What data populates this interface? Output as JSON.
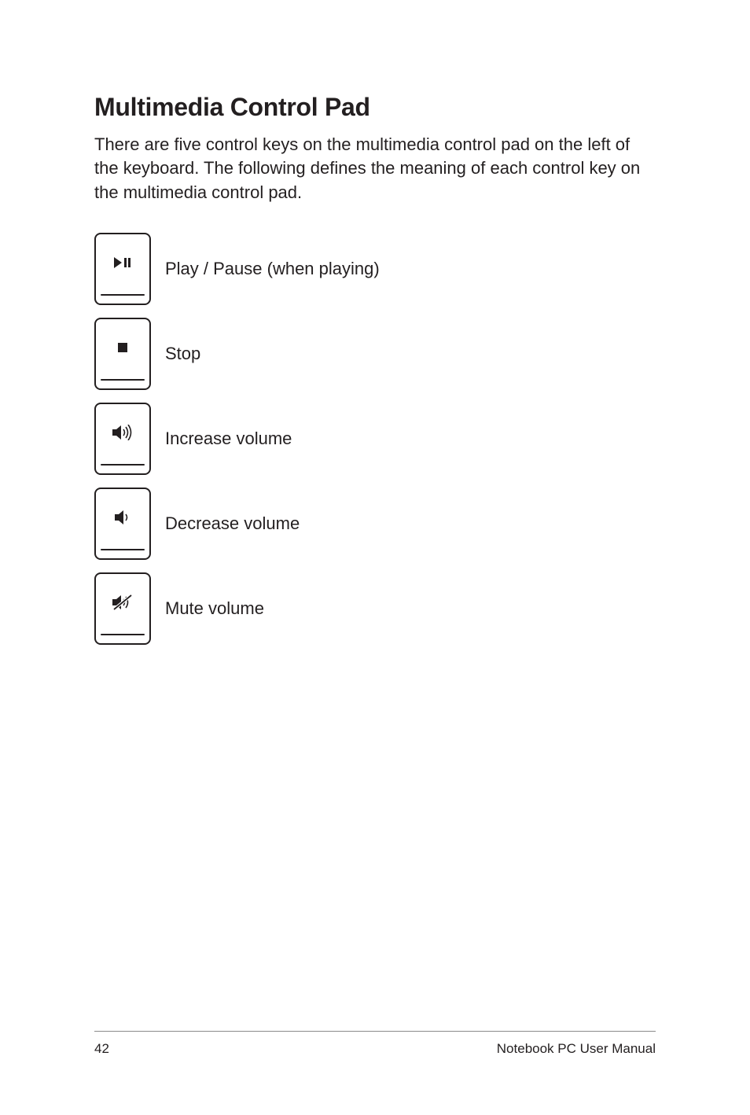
{
  "heading": "Multimedia Control Pad",
  "intro": "There are five control keys on the multimedia control pad on the left of the keyboard. The following defines the meaning of each control key on the multimedia control pad.",
  "controls": {
    "play_pause": "Play / Pause (when playing)",
    "stop": "Stop",
    "volume_up": "Increase volume",
    "volume_down": "Decrease volume",
    "mute": "Mute volume"
  },
  "footer": {
    "page_number": "42",
    "doc_title": "Notebook PC User Manual"
  }
}
